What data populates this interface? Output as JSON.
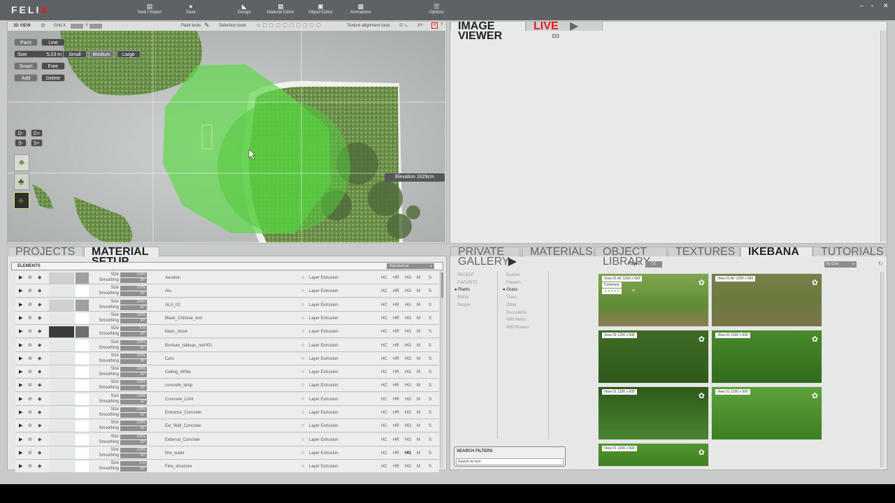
{
  "app": {
    "logo": "FELIX",
    "accent": "#e21b23"
  },
  "toolbar": {
    "new_import": "New / Import",
    "save": "Save",
    "design": "Design",
    "material_editor": "Material Editor",
    "object_editor": "Object Editor",
    "animations": "Animations",
    "options": "Options"
  },
  "window_controls": [
    "–",
    "▫",
    "✕"
  ],
  "view3d": {
    "title": "3D VIEW",
    "grid_x": "Grid X",
    "grid_y": "Y",
    "paint_tools": "Paint tools",
    "selection_tools": "Selection tools",
    "texture_alignment": "Texture alignment tools",
    "xy": "XY",
    "help": "?",
    "paint": "Paint",
    "line": "Line",
    "size_label": "Size",
    "size_value": "5.23 m",
    "small": "Small",
    "medium": "Medium",
    "large": "Large",
    "smart": "Smart",
    "free": "Free",
    "add": "Add",
    "delete": "Delete",
    "d_minus": "D-",
    "d_plus": "D+",
    "s_minus": "S-",
    "s_plus": "S+",
    "elevation": "Elevation 1629cm"
  },
  "image_viewer": {
    "title": "IMAGE VIEWER",
    "live": "LIVE",
    "play": "▶",
    "link": "∞"
  },
  "left_tabs": {
    "projects": "PROJECTS",
    "material_setup": "MATERIAL SETUP"
  },
  "elements": {
    "title": "ELEMENTS",
    "sort": "Alphabetical",
    "size_label": "Size",
    "smoothing_label": "Smoothing",
    "layer": "Layer Extrusion",
    "flags": [
      "HC",
      "HR",
      "HG",
      "M",
      "S"
    ],
    "rows": [
      {
        "name": "Aeration",
        "size": "100%",
        "smooth": "30°",
        "thumb": "sphere"
      },
      {
        "name": "Alu",
        "size": "100%",
        "smooth": "30°",
        "thumb": "light"
      },
      {
        "name": "ALU_02",
        "size": "100%",
        "smooth": "30°",
        "thumb": "sphere"
      },
      {
        "name": "Black_Chinese_text",
        "size": "100%",
        "smooth": "30°",
        "thumb": "light"
      },
      {
        "name": "black_stone",
        "size": "6 m",
        "smooth": "30°",
        "thumb": "dark"
      },
      {
        "name": "Bordure_tableau_noir001",
        "size": "100%",
        "smooth": "30°",
        "thumb": "light"
      },
      {
        "name": "Cars",
        "size": "100%",
        "smooth": "30°",
        "thumb": "light"
      },
      {
        "name": "Ceiling_White",
        "size": "100%",
        "smooth": "30°",
        "thumb": "light"
      },
      {
        "name": "concrete_lamp",
        "size": "100%",
        "smooth": "30°",
        "thumb": "light"
      },
      {
        "name": "Concrete_Limit",
        "size": "100%",
        "smooth": "30°",
        "thumb": "light"
      },
      {
        "name": "Entrance_Concrete",
        "size": "100%",
        "smooth": "30°",
        "thumb": "light"
      },
      {
        "name": "Ext_Wall_Concrete",
        "size": "100%",
        "smooth": "30°",
        "thumb": "light"
      },
      {
        "name": "External_Concrete",
        "size": "100%",
        "smooth": "30°",
        "thumb": "light"
      },
      {
        "name": "fine_water",
        "size": "100%",
        "smooth": "30°",
        "thumb": "light"
      },
      {
        "name": "Fine_structure",
        "size": "6 m",
        "smooth": "30°",
        "thumb": "light"
      }
    ]
  },
  "right_tabs": {
    "private_gallery": "PRIVATE GALLERY",
    "materials": "MATERIALS",
    "object_library": "OBJECT LIBRARY",
    "textures": "TEXTURES",
    "ikebana": "IKEBANA",
    "tutorials": "TUTORIALS"
  },
  "ikebana": {
    "pages_label": "Pages",
    "pages_value": "1/1",
    "sort": "By Date",
    "cats_left": [
      "RECENT",
      "FAVORITE",
      "Plants",
      "Rocks",
      "People"
    ],
    "cats_right": [
      "Bushes",
      "Flowers",
      "Grass",
      "Trees",
      "Other",
      "Succulents",
      "Wild herbs",
      "Wild flowers"
    ],
    "selected_left": "Plants",
    "selected_right": "Grass",
    "search_title": "SEARCH FILTERS",
    "search_placeholder": "Search by text",
    "thumbs": [
      {
        "label": "View 01   AV   1200 x 600",
        "comment": "Comment",
        "stars": "★★★★★"
      },
      {
        "label": "View 01   AV   1200 x 600"
      },
      {
        "label": "View 02   1200 x 600"
      },
      {
        "label": "View 01   1200 x 600"
      },
      {
        "label": "View 01   1200 x 600"
      },
      {
        "label": "View 01   1200 x 600"
      },
      {
        "label": "View 01   1200 x 600"
      }
    ]
  }
}
